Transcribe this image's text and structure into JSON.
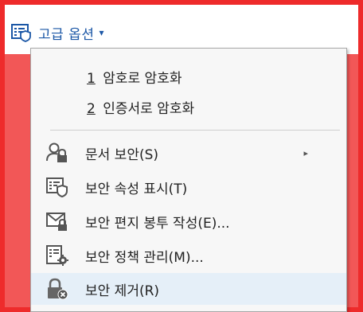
{
  "toolbar": {
    "label": "고급 옵션",
    "caret": "▾"
  },
  "menu": {
    "encrypt_items": [
      {
        "num": "1",
        "label": " 암호로 암호화"
      },
      {
        "num": "2",
        "label": " 인증서로 암호화"
      }
    ],
    "items": [
      {
        "label": "문서 보안(S)",
        "icon": "user-lock-icon",
        "submenu_arrow": "▸"
      },
      {
        "label": "보안 속성 표시(T)",
        "icon": "certificate-shield-icon"
      },
      {
        "label": "보안 편지 봉투 작성(E)...",
        "icon": "envelope-lock-icon"
      },
      {
        "label": "보안 정책 관리(M)...",
        "icon": "document-gear-icon"
      },
      {
        "label": "보안 제거(R)",
        "icon": "lock-remove-icon"
      }
    ]
  },
  "colors": {
    "frame": "#ee2b2b",
    "accent": "#1b57a6",
    "hover": "#e5eff8"
  }
}
